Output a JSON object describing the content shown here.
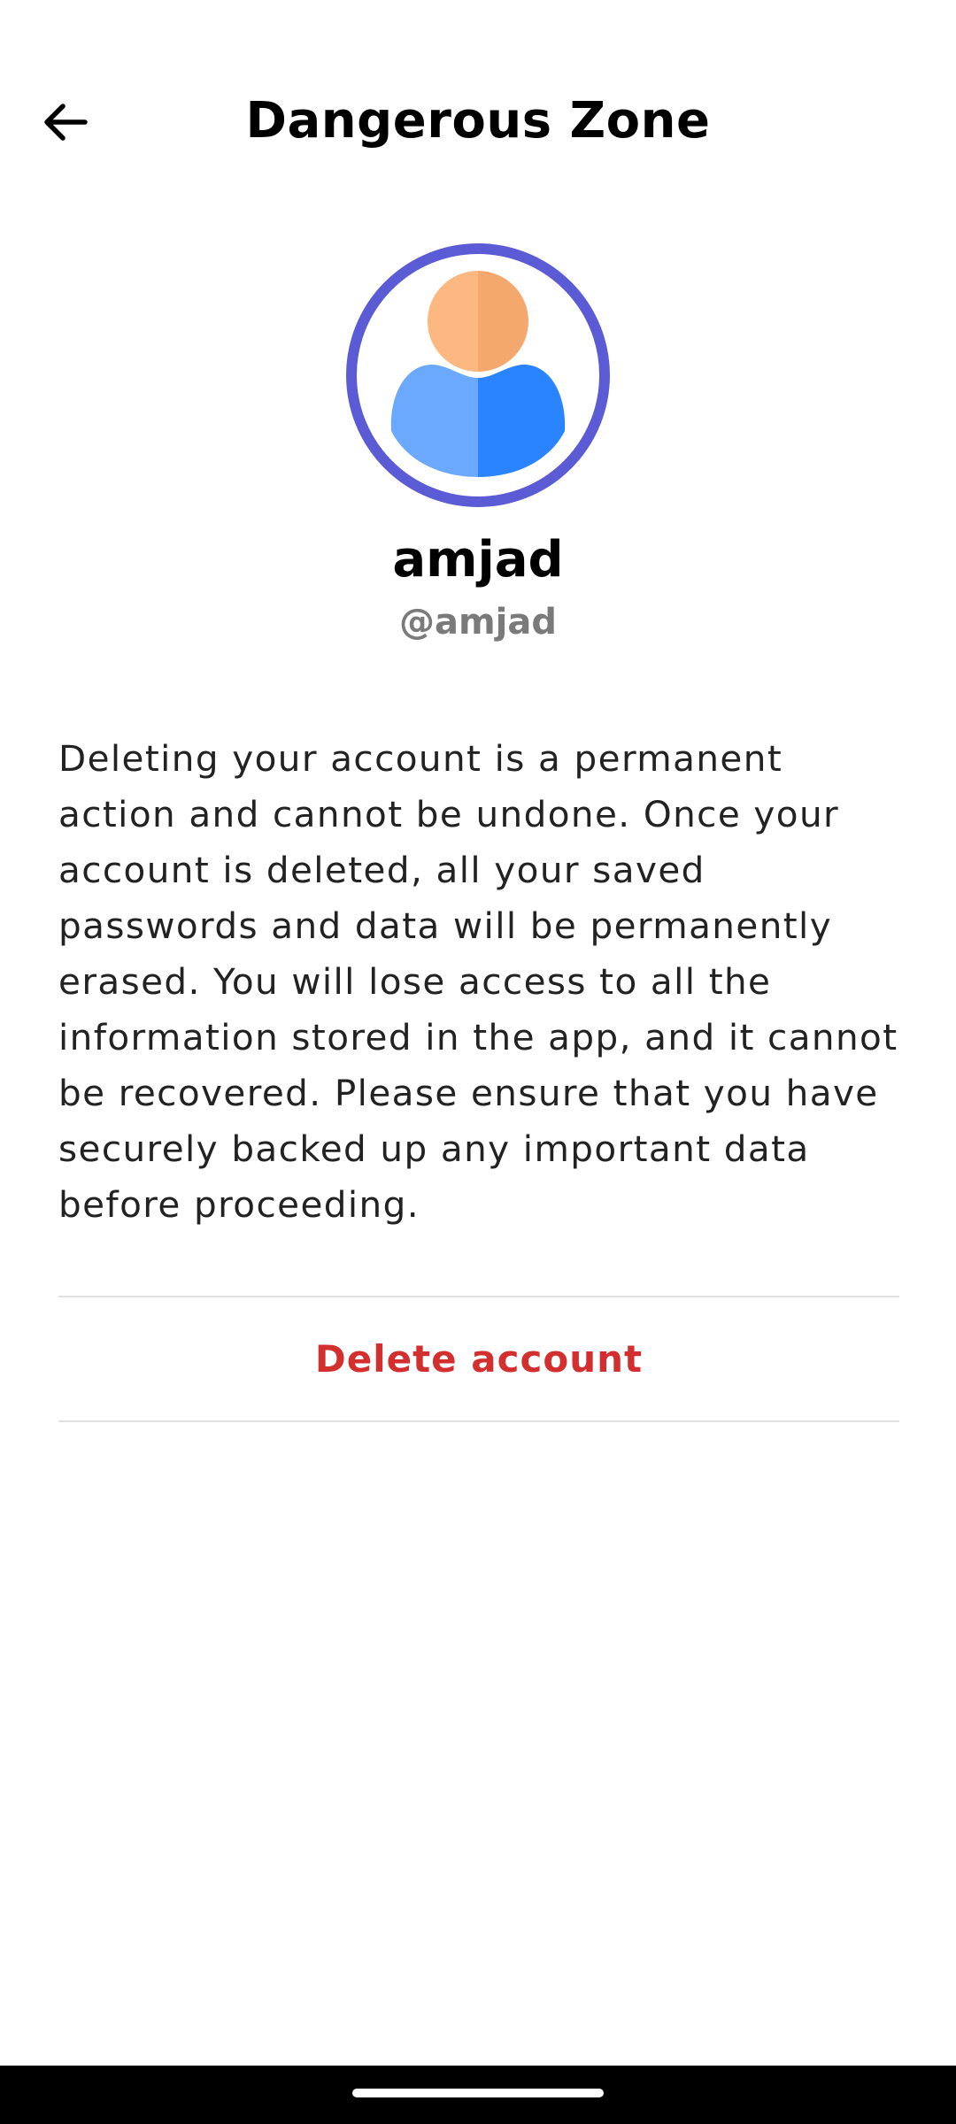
{
  "header": {
    "title": "Dangerous Zone",
    "back_icon": "arrow-left-icon"
  },
  "profile": {
    "avatar_icon": "user-avatar-icon",
    "display_name": "amjad",
    "username": "@amjad",
    "colors": {
      "ring": "#5b5bd6",
      "head_light": "#fdb882",
      "head_dark": "#f5a86e",
      "body_light": "#6aa9ff",
      "body_dark": "#2a84ff"
    }
  },
  "warning": {
    "text": "Deleting your account is a permanent action and cannot be undone. Once your account is deleted, all your saved passwords and data will be permanently erased. You will lose access to all the information stored in the app, and it cannot be recovered. Please ensure that you have securely backed up any important data before proceeding."
  },
  "actions": {
    "delete_label": "Delete account",
    "delete_color": "#d32f2f"
  },
  "system": {
    "home_indicator": "home-indicator"
  }
}
